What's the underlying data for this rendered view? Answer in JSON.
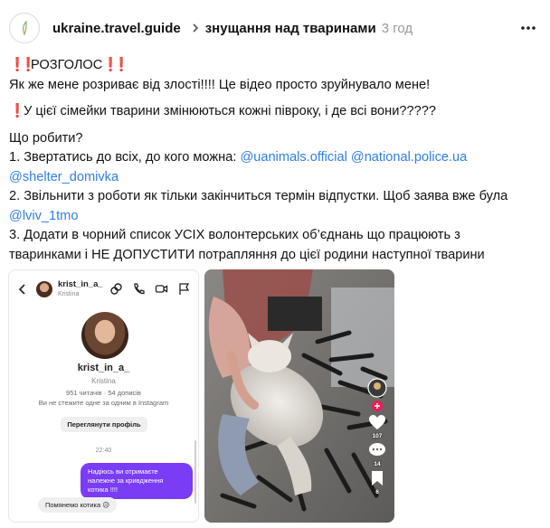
{
  "header": {
    "author": "ukraine.travel.guide",
    "topic": "знущання над тваринами",
    "time": "3 год"
  },
  "post": {
    "line1": "РОЗГОЛОС",
    "line2": "Як же мене розриває від злості!!!! Це відео просто зруйнувало мене!",
    "line3": "У цієї сімейки тварини змінюються кожні півроку, і де всі вони?????",
    "line4": "Що робити?",
    "line5": "1. Звертатись до всіх, до кого можна: ",
    "mention1": "@uanimals.official",
    "mention2": "@national.police.ua",
    "mention3": "@shelter_domivka",
    "line6": "2. Звільнити з роботи як тільки закінчиться термін відпустки. Щоб заява вже була",
    "mention4": "@lviv_1tmo",
    "line7": "3. Додати в чорний список УСІХ волонтерських об’єднань що працюють з",
    "line8": "тваринками і НЕ ДОПУСТИТИ потрапляння до цієї родини наступної тварини"
  },
  "chat": {
    "username_top": "krist_in_a_",
    "realname_top": "Kristina",
    "username": "krist_in_a_",
    "realname": "Kristina",
    "stats": "951 читачів · 54 дописів",
    "info": "Ви не стежите одне за одним в Instagram",
    "profile_button": "Переглянути профіль",
    "time": "22:40",
    "message_out": "Надіюсь ви отримаєте належне за кривдження котика !!!!",
    "message_in": "Помянемо котика 😥"
  },
  "video": {
    "likes": "107",
    "comments": "14",
    "saves": "6"
  },
  "colors": {
    "mention": "#2f7ee6",
    "accent": "#7a3cf5",
    "alert": "#e0242c"
  }
}
